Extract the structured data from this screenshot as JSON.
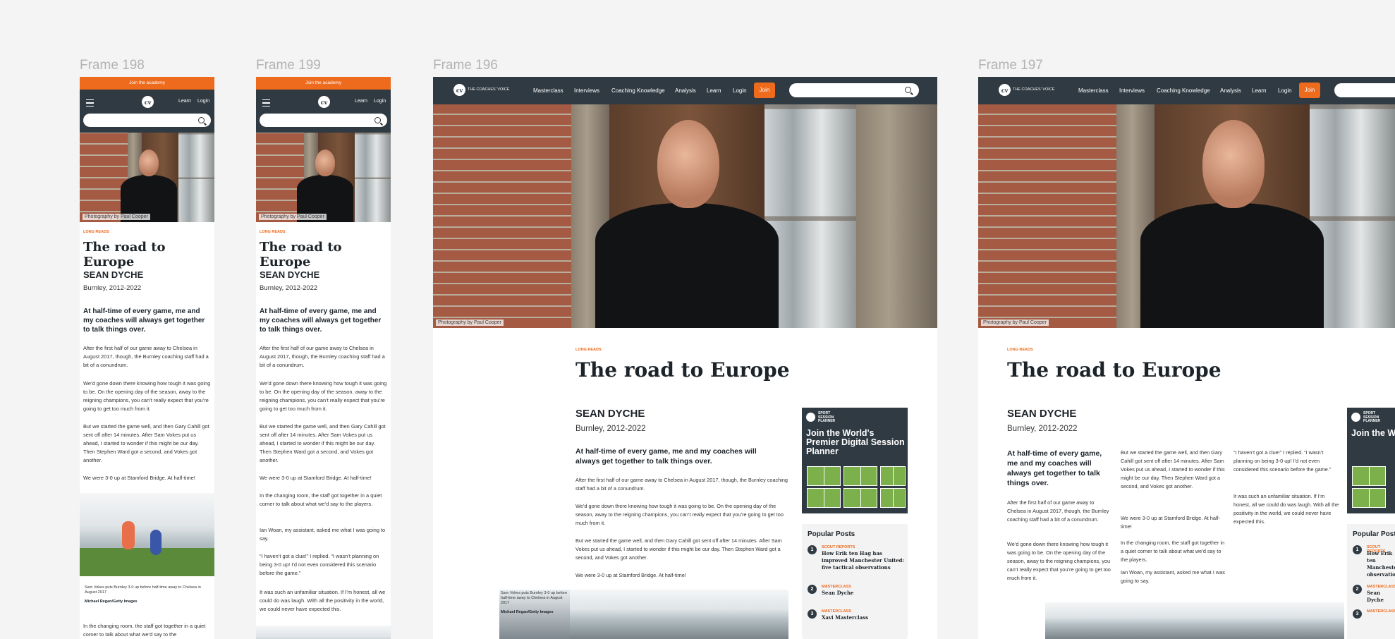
{
  "frames": {
    "f198": "Frame 198",
    "f199": "Frame 199",
    "f196": "Frame 196",
    "f197": "Frame 197"
  },
  "promo_bar": "Join the academy",
  "logo_mark": "cv",
  "logo_text": "THE COACHES' VOICE",
  "nav": [
    "Masterclass",
    "Interviews",
    "Coaching Knowledge",
    "Analysis",
    "Learn",
    "Login"
  ],
  "nav_join": "Join",
  "mobile_nav": {
    "learn": "Learn",
    "login": "Login"
  },
  "photo_credit": "Photography by Paul Cooper",
  "article": {
    "category": "LONG READS",
    "title": "The road to Europe",
    "name": "SEAN DYCHE",
    "club": "Burnley, 2012-2022",
    "standfirst": "At half-time of every game, me and my coaches will always get together to talk things over.",
    "p1": "After the first half of our game away to Chelsea in August 2017, though, the Burnley coaching staff had a bit of a conundrum.",
    "p2": "We’d gone down there knowing how tough it was going to be. On the opening day of the season, away to the reigning champions, you can’t really expect that you’re going to get too much from it.",
    "p3": "But we started the game well, and then Gary Cahill got sent off after 14 minutes. After Sam Vokes put us ahead, I started to wonder if this might be our day. Then Stephen Ward got a second, and Vokes got another.",
    "p4": "We were 3-0 up at Stamford Bridge. At half-time!",
    "p5": "In the changing room, the staff got together in a quiet corner to talk about what we’d say to the players.",
    "p6": "Ian Woan, my assistant, asked me what I was going to say.",
    "p7": "“I haven’t got a clue!” I replied. “I wasn’t planning on being 3-0 up! I’d not even considered this scenario before the game.”",
    "p8": "It was such an unfamiliar situation. If I’m honest, all we could do was laugh. With all the positivity in the world, we could never have expected this.",
    "img_caption": "Sam Vokes puts Burnley 3-0 up before half-time away to Chelsea in August 2017",
    "img_credit": "Michael Regan/Getty Images",
    "p5_cut": "In the changing room, the staff got together in a quiet corner to talk about what we’d say to the"
  },
  "ad": {
    "brand1": "SPORT",
    "brand2": "SESSION",
    "brand3": "PLANNER",
    "headline": "Join the World's Premier Digital Session Planner",
    "headline_cut": "Join the W Premier Di Session P"
  },
  "popular": {
    "title": "Popular Posts",
    "title_cut": "Popular Posts",
    "items": [
      {
        "num": "1",
        "cat": "SCOUT REPORTS",
        "title": "How Erik ten Hag has improved Manchester United: five tactical observations",
        "cut": "How Erik ten Manchester observation"
      },
      {
        "num": "2",
        "cat": "MASTERCLASS",
        "title": "Sean Dyche"
      },
      {
        "num": "3",
        "cat": "MASTERCLASS",
        "title": "Xavi Masterclass"
      }
    ]
  },
  "colors": {
    "accent": "#ee6a1c",
    "header": "#2f3a42",
    "canvas": "#f4f4f4"
  }
}
